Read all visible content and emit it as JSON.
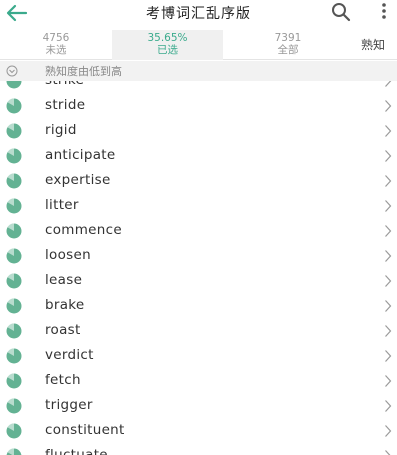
{
  "header": {
    "title": "考博词汇乱序版",
    "icons": {
      "back": "arrow-left-icon",
      "search": "search-icon",
      "more": "more-vert-icon"
    },
    "accent_color": "#3aaa8c"
  },
  "tabs": {
    "unselected": {
      "count": "4756",
      "label": "未选"
    },
    "selected": {
      "count": "35.65%",
      "label": "已选"
    },
    "all": {
      "count": "7391",
      "label": "全部"
    },
    "known": {
      "label": "熟知"
    }
  },
  "sort": {
    "label": "熟知度由低到高",
    "icon": "sort-chevron-icon"
  },
  "words": [
    "strike",
    "stride",
    "rigid",
    "anticipate",
    "expertise",
    "litter",
    "commence",
    "loosen",
    "lease",
    "brake",
    "roast",
    "verdict",
    "fetch",
    "trigger",
    "constituent",
    "fluctuate"
  ],
  "row_icons": {
    "status": "familiarity-pie-icon",
    "open": "chevron-right-icon"
  },
  "colors": {
    "pie": "#63b293",
    "chevron": "#9a9a9a"
  }
}
